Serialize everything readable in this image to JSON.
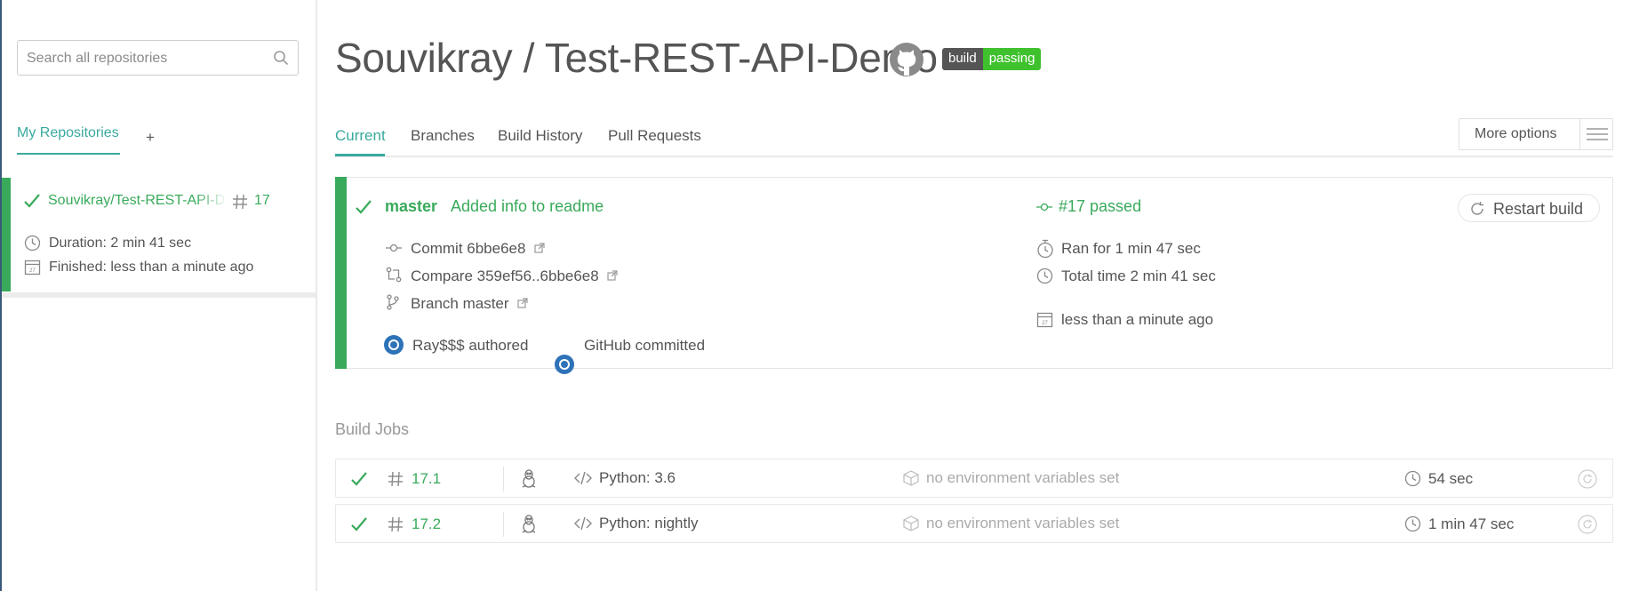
{
  "sidebar": {
    "search_placeholder": "Search all repositories",
    "my_repositories_tab": "My Repositories",
    "add_label": "+",
    "repo": {
      "name": "Souvikray/Test-REST-API-Demo",
      "build_number": "17",
      "duration": "Duration: 2 min 41 sec",
      "finished": "Finished: less than a minute ago",
      "status_color": "#39aa5b"
    }
  },
  "header": {
    "title": "Souvikray / Test-REST-API-Demo",
    "badge_left": "build",
    "badge_right": "passing",
    "badge_left_color": "#555555",
    "badge_right_color": "#3fc12e"
  },
  "tabs": [
    {
      "label": "Current",
      "active": true
    },
    {
      "label": "Branches",
      "active": false
    },
    {
      "label": "Build History",
      "active": false
    },
    {
      "label": "Pull Requests",
      "active": false
    }
  ],
  "more_options_label": "More options",
  "build": {
    "branch": "master",
    "message": "Added info to readme",
    "status": "#17 passed",
    "commit": "Commit 6bbe6e8",
    "compare": "Compare 359ef56..6bbe6e8",
    "branch_link": "Branch master",
    "author": "Ray$$$ authored",
    "committer": "GitHub committed",
    "ran_for": "Ran for 1 min 47 sec",
    "total_time": "Total time 2 min 41 sec",
    "finished": "less than a minute ago",
    "restart_label": "Restart build"
  },
  "build_jobs": {
    "title": "Build Jobs",
    "jobs": [
      {
        "number": "17.1",
        "language": "Python: 3.6",
        "env": "no environment variables set",
        "duration": "54 sec"
      },
      {
        "number": "17.2",
        "language": "Python: nightly",
        "env": "no environment variables set",
        "duration": "1 min 47 sec"
      }
    ]
  },
  "colors": {
    "passed": "#39aa5b",
    "teal_accent": "#39aa9e",
    "text": "#555555"
  }
}
